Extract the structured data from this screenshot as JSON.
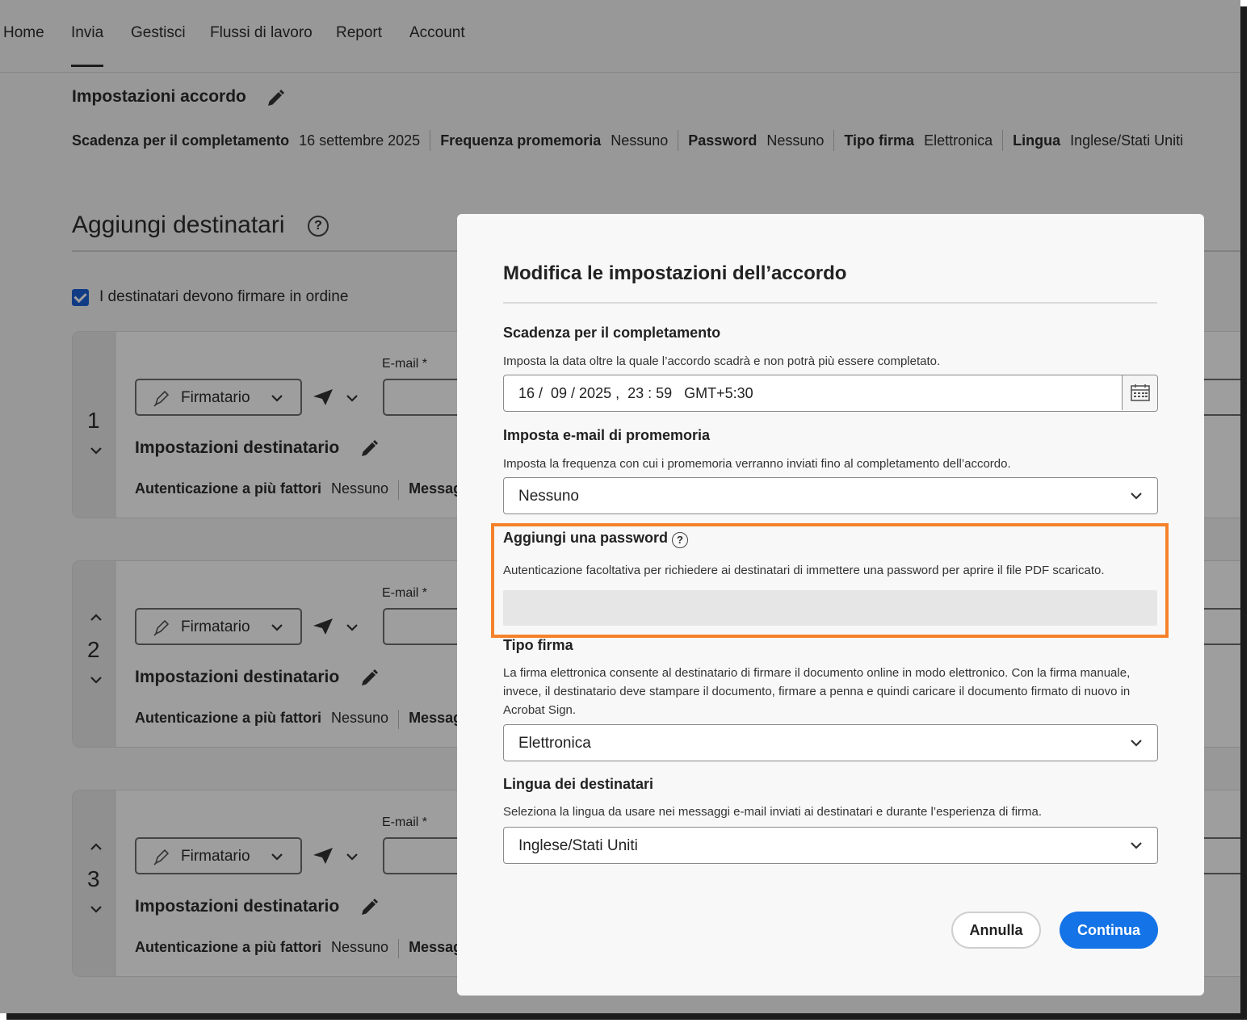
{
  "nav": {
    "items": [
      {
        "label": "Home"
      },
      {
        "label": "Invia"
      },
      {
        "label": "Gestisci"
      },
      {
        "label": "Flussi di lavoro"
      },
      {
        "label": "Report"
      },
      {
        "label": "Account"
      }
    ],
    "active": "Invia"
  },
  "agreement_settings": {
    "title": "Impostazioni accordo",
    "deadline_label": "Scadenza per il completamento",
    "deadline_value": "16 settembre 2025",
    "reminder_label": "Frequenza promemoria",
    "reminder_value": "Nessuno",
    "password_label": "Password",
    "password_value": "Nessuno",
    "signature_label": "Tipo firma",
    "signature_value": "Elettronica",
    "language_label": "Lingua",
    "language_value": "Inglese/Stati Uniti"
  },
  "recipients": {
    "title": "Aggiungi destinatari",
    "help_glyph": "?",
    "order_label": "I destinatari devono firmare in ordine",
    "order_checked": true,
    "cards": [
      {
        "number": "1",
        "role": "Firmatario",
        "email_label": "E-mail *",
        "settings_title": "Impostazioni destinatario",
        "auth_label": "Autenticazione a più fattori",
        "auth_value": "Nessuno",
        "message_label": "Messag"
      },
      {
        "number": "2",
        "role": "Firmatario",
        "email_label": "E-mail *",
        "settings_title": "Impostazioni destinatario",
        "auth_label": "Autenticazione a più fattori",
        "auth_value": "Nessuno",
        "message_label": "Messag"
      },
      {
        "number": "3",
        "role": "Firmatario",
        "email_label": "E-mail *",
        "settings_title": "Impostazioni destinatario",
        "auth_label": "Autenticazione a più fattori",
        "auth_value": "Nessuno",
        "message_label": "Messag"
      }
    ]
  },
  "dialog": {
    "title": "Modifica le impostazioni dell’accordo",
    "deadline": {
      "heading": "Scadenza per il completamento",
      "description": "Imposta la data oltre la quale l’accordo scadrà e non potrà più essere completato.",
      "value": "16 /  09 / 2025 ,  23 : 59   GMT+5:30"
    },
    "reminder": {
      "heading": "Imposta e-mail di promemoria",
      "description": "Imposta la frequenza con cui i promemoria verranno inviati fino al completamento dell’accordo.",
      "value": "Nessuno"
    },
    "password": {
      "heading": "Aggiungi una password",
      "help_glyph": "?",
      "description": "Autenticazione facoltativa per richiedere ai destinatari di immettere una password per aprire il file PDF scaricato."
    },
    "signature_type": {
      "heading": "Tipo firma",
      "description": "La firma elettronica consente al destinatario di firmare il documento online in modo elettronico. Con la firma manuale, invece, il destinatario deve stampare il documento, firmare a penna e quindi caricare il documento firmato di nuovo in Acrobat Sign.",
      "value": "Elettronica"
    },
    "language": {
      "heading": "Lingua dei destinatari",
      "description": "Seleziona la lingua da usare nei messaggi e-mail inviati ai destinatari e durante l’esperienza di firma.",
      "value": "Inglese/Stati Uniti"
    },
    "cancel_label": "Annulla",
    "continue_label": "Continua"
  },
  "colors": {
    "accent": "#1473e6",
    "highlight": "#f5822a",
    "checkbox": "#1c5fd6"
  }
}
